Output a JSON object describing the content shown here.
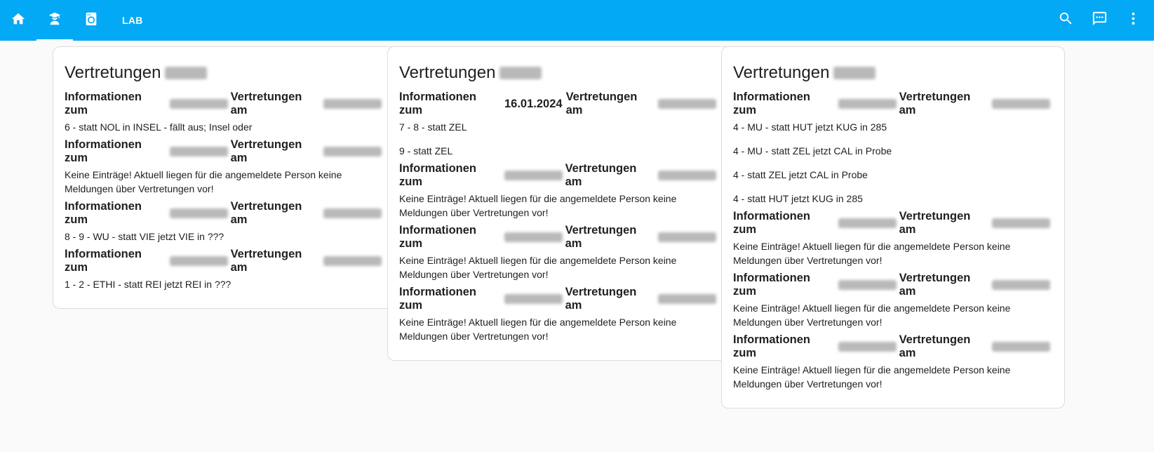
{
  "nav": {
    "tabs": [
      {
        "icon": "home-icon"
      },
      {
        "icon": "student-icon",
        "active": true
      },
      {
        "icon": "washing-machine-icon"
      }
    ],
    "lab_label": "LAB",
    "actions": [
      {
        "icon": "search-icon"
      },
      {
        "icon": "chat-icon"
      },
      {
        "icon": "more-vertical-icon"
      }
    ]
  },
  "cards": [
    {
      "title": "Vertretungen",
      "blocks": [
        {
          "info_prefix": "Informationen zum",
          "info_date": "",
          "vert_label": "Vertretungen am",
          "lines": [
            "6 - statt NOL in INSEL - fällt aus; Insel oder"
          ]
        },
        {
          "info_prefix": "Informationen zum",
          "info_date": "",
          "vert_label": "Vertretungen am",
          "lines": [
            "Keine Einträge! Aktuell liegen für die angemeldete Person keine Meldungen über Vertretungen vor!"
          ]
        },
        {
          "info_prefix": "Informationen zum",
          "info_date": "",
          "vert_label": "Vertretungen am",
          "lines": [
            "8 - 9 - WU - statt VIE jetzt VIE in ???"
          ]
        },
        {
          "info_prefix": "Informationen zum",
          "info_date": "",
          "vert_label": "Vertretungen am",
          "lines": [
            "1 - 2 - ETHI - statt REI jetzt REI in ???"
          ]
        }
      ]
    },
    {
      "title": "Vertretungen",
      "blocks": [
        {
          "info_prefix": "Informationen zum",
          "info_date": "16.01.2024",
          "vert_label": "Vertretungen am",
          "lines": [
            "7 - 8 - statt ZEL",
            "9 - statt ZEL"
          ]
        },
        {
          "info_prefix": "Informationen zum",
          "info_date": "",
          "vert_label": "Vertretungen am",
          "lines": [
            "Keine Einträge! Aktuell liegen für die angemeldete Person keine Meldungen über Vertretungen vor!"
          ]
        },
        {
          "info_prefix": "Informationen zum",
          "info_date": "",
          "vert_label": "Vertretungen am",
          "lines": [
            "Keine Einträge! Aktuell liegen für die angemeldete Person keine Meldungen über Vertretungen vor!"
          ]
        },
        {
          "info_prefix": "Informationen zum",
          "info_date": "",
          "vert_label": "Vertretungen am",
          "lines": [
            "Keine Einträge! Aktuell liegen für die angemeldete Person keine Meldungen über Vertretungen vor!"
          ]
        }
      ]
    },
    {
      "title": "Vertretungen",
      "blocks": [
        {
          "info_prefix": "Informationen zum",
          "info_date": "",
          "vert_label": "Vertretungen am",
          "lines": [
            "4 - MU - statt HUT jetzt KUG in 285",
            "4 - MU - statt ZEL jetzt CAL in Probe",
            "4 - statt ZEL jetzt CAL in Probe",
            "4 - statt HUT jetzt KUG in 285"
          ]
        },
        {
          "info_prefix": "Informationen zum",
          "info_date": "",
          "vert_label": "Vertretungen am",
          "lines": [
            "Keine Einträge! Aktuell liegen für die angemeldete Person keine Meldungen über Vertretungen vor!"
          ]
        },
        {
          "info_prefix": "Informationen zum",
          "info_date": "",
          "vert_label": "Vertretungen am",
          "lines": [
            "Keine Einträge! Aktuell liegen für die angemeldete Person keine Meldungen über Vertretungen vor!"
          ]
        },
        {
          "info_prefix": "Informationen zum",
          "info_date": "",
          "vert_label": "Vertretungen am",
          "lines": [
            "Keine Einträge! Aktuell liegen für die angemeldete Person keine Meldungen über Vertretungen vor!"
          ]
        }
      ]
    }
  ]
}
